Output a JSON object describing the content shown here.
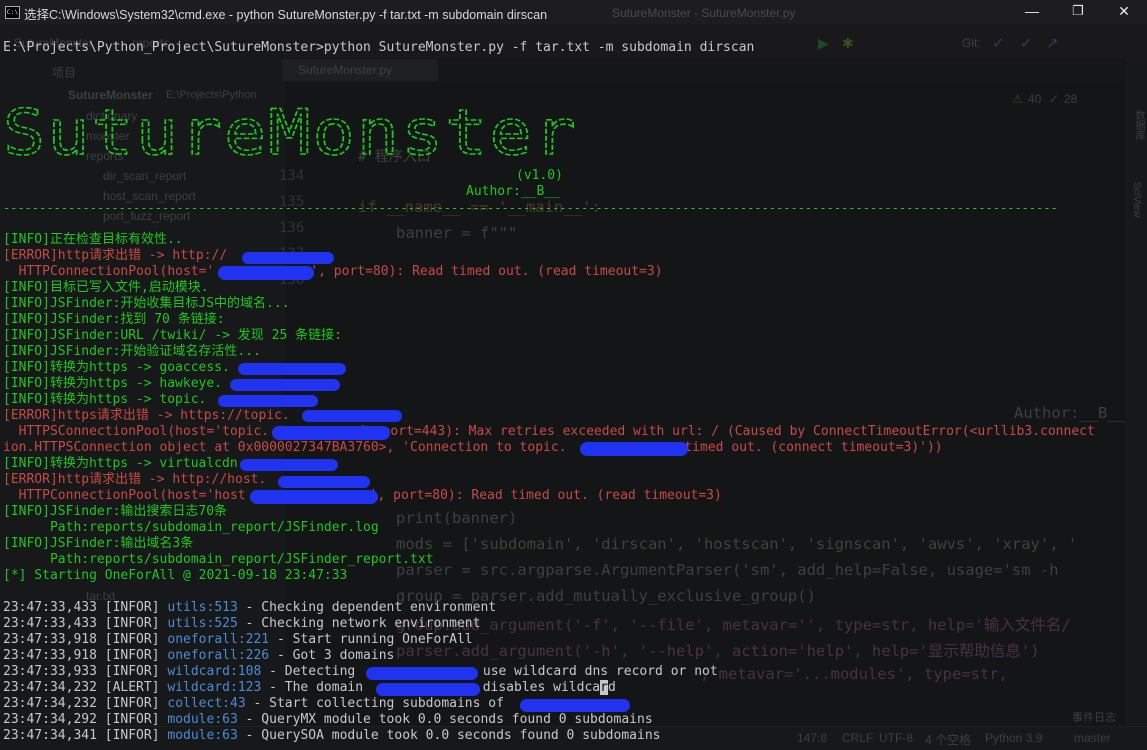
{
  "window": {
    "title": "选择C:\\Windows\\System32\\cmd.exe - python  SutureMonster.py -f tar.txt -m subdomain dirscan",
    "behind_title": "SutureMonster - SutureMonster.py",
    "icon_label": "C:\\",
    "minimize": "—",
    "maximize": "❐",
    "close": "✕"
  },
  "ide_ghost": {
    "breadcrumb_project": "SutureMonster",
    "breadcrumb_folder": "reports",
    "project_label": "项目",
    "project_root": "SutureMonster",
    "project_path": "E:\\Projects\\Python",
    "tree": [
      "dictionary",
      "monster",
      "reports",
      "dir_scan_report",
      "host_scan_report",
      "port_fuzz_report",
      "tar.txt"
    ],
    "editor_tab": "SutureMonster.py",
    "line_numbers": [
      "134",
      "135",
      "136",
      "137",
      "138"
    ],
    "comment": "# 程序入口",
    "inspection_warn": "40",
    "inspection_ok": "28",
    "vcs_label": "Git:",
    "status_position": "147:8",
    "status_crlf": "CRLF",
    "status_encoding": "UTF-8",
    "status_indent": "4 个空格",
    "status_python": "Python 3.9",
    "status_branch": "master",
    "event_log": "事件日志",
    "sidebar_right": [
      "数据库",
      "SciView"
    ],
    "code": {
      "if_main": "if __name__ == '__main__':",
      "banner": "banner = f\"\"\"",
      "print_banner": "print(banner)",
      "mods": "mods = ['subdomain', 'dirscan', 'hostscan', 'signscan', 'awvs', 'xray', '",
      "parser": "parser = src.argparse.ArgumentParser('sm', add_help=False, usage='sm -h",
      "group": "group = parser.add_mutually_exclusive_group()",
      "add_file": "group.add_argument('-f', '--file', metavar='', type=str, help='输入文件名/",
      "add_help": "parser.add_argument('-h', '--help', action='help', help='显示帮助信息')",
      "add_mod": ", metavar='...modules', type=str,",
      "author": "Author:__B__"
    }
  },
  "terminal": {
    "prompt": "E:\\Projects\\Python_Project\\SutureMonster>python SutureMonster.py -f tar.txt -m subdomain dirscan",
    "ascii_art": [
      " ____        _                    __  __                 _            ",
      "/ ___| _   _| |_ _   _ _ __ ___  |  \\/  | ___  _ __  ___| |_ ___ _ __ ",
      "\\___ \\| | | | __| | | | '__/ _ \\ | |\\/| |/ _ \\| '_ \\/ __| __/ _ \\ '__|",
      " ___) | |_| | |_| |_| | | |  __/ | |  | | (_) | | | \\__ \\ ||  __/ |   ",
      "|____/ \\__,_|\\__|\\__,_|_|  \\___| |_|  |_|\\___/|_| |_|___/\\__\\___|_|   "
    ],
    "version": "(v1.0)",
    "author": "Author:__B__",
    "separator": "--------------------------------------------------------------------------------------------------------------------------------------------------",
    "lines": {
      "l01": "[INFO]正在检查目标有效性..",
      "l02": "[ERROR]http请求出错 -> http://",
      "l03": "  HTTPConnectionPool(host='",
      "l03b": "', port=80): Read timed out. (read timeout=3)",
      "l04": "[INFO]目标已写入文件,启动模块.",
      "l05": "[INFO]JSFinder:开始收集目标JS中的域名...",
      "l06": "[INFO]JSFinder:找到 70 条链接:",
      "l07": "[INFO]JSFinder:URL /twiki/ -> 发现 25 条链接:",
      "l08": "[INFO]JSFinder:开始验证域名存活性...",
      "l09": "[INFO]转换为https -> goaccess.",
      "l10": "[INFO]转换为https -> hawkeye.",
      "l11": "[INFO]转换为https -> topic.",
      "l12": "[ERROR]https请求出错 -> https://topic.",
      "l13": "  HTTPSConnectionPool(host='topic.",
      "l13b": "', port=443): Max retries exceeded with url: / (Caused by ConnectTimeoutError(<urllib3.connect",
      "l14": "ion.HTTPSConnection object at 0x0000027347BA3760>, 'Connection to topic.",
      "l14b": " timed out. (connect timeout=3)'))",
      "l15": "[INFO]转换为https -> virtualcdn.",
      "l16": "[ERROR]http请求出错 -> http://host.",
      "l17": "  HTTPConnectionPool(host='host",
      "l17b": "', port=80): Read timed out. (read timeout=3)",
      "l18": "[INFO]JSFinder:输出搜索日志70条",
      "l19": "      Path:reports/subdomain_report/JSFinder.log",
      "l20": "[INFO]JSFinder:输出域名3条",
      "l21": "      Path:reports/subdomain_report/JSFinder_report.txt",
      "l22": "[*] Starting OneForAll @ 2021-09-18 23:47:33"
    },
    "logs": [
      {
        "time": "23:47:33,433",
        "level": "[INFOR]",
        "src": "utils:513",
        "msg": " - Checking dependent environment"
      },
      {
        "time": "23:47:33,433",
        "level": "[INFOR]",
        "src": "utils:525",
        "msg": " - Checking network environment"
      },
      {
        "time": "23:47:33,918",
        "level": "[INFOR]",
        "src": "oneforall:221",
        "msg": " - Start running OneForAll"
      },
      {
        "time": "23:47:33,918",
        "level": "[INFOR]",
        "src": "oneforall:226",
        "msg": " - Got 3 domains"
      },
      {
        "time": "23:47:33,933",
        "level": "[INFOR]",
        "src": "wildcard:108",
        "msg": " - Detecting ",
        "msg2": " use wildcard dns record or not"
      },
      {
        "time": "23:47:34,232",
        "level": "[ALERT]",
        "src": "wildcard:123",
        "msg": " - The domain ",
        "msg2": " disables wildca",
        "cursor": "r",
        "msg3": "d"
      },
      {
        "time": "23:47:34,232",
        "level": "[INFOR]",
        "src": "collect:43",
        "msg": " - Start collecting subdomains of "
      },
      {
        "time": "23:47:34,292",
        "level": "[INFOR]",
        "src": "module:63",
        "msg": " - QueryMX module took 0.0 seconds found 0 subdomains"
      },
      {
        "time": "23:47:34,341",
        "level": "[INFOR]",
        "src": "module:63",
        "msg": " - QuerySOA module took 0.0 seconds found 0 subdomains"
      }
    ]
  },
  "colors": {
    "terminal_bg": "#0c0c0c",
    "info_green": "#1ec81e",
    "error_red": "#c84a42",
    "log_blue": "#4a8bd8",
    "redaction_blue": "#1f33f0"
  }
}
